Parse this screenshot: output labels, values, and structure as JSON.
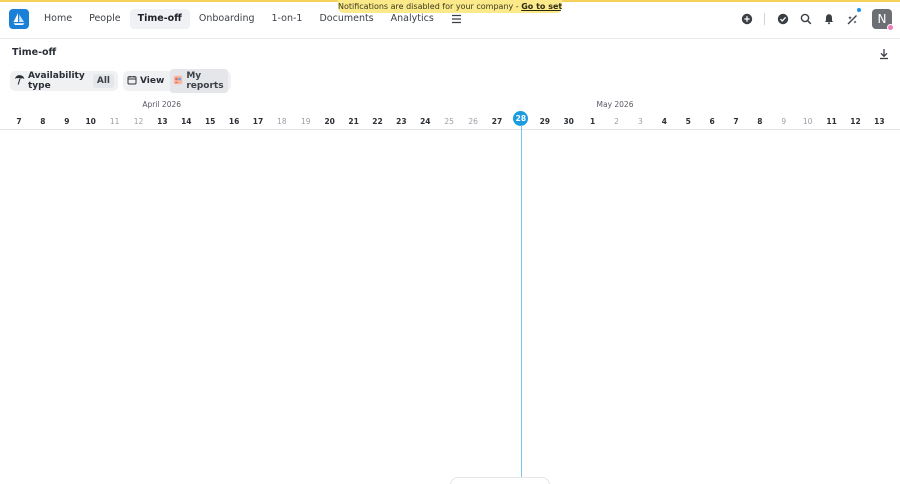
{
  "banner": {
    "text": "Notifications are disabled for your company - ",
    "link": "Go to settings"
  },
  "nav": {
    "logo": "sail-logo-icon",
    "items": [
      {
        "label": "Home",
        "active": false
      },
      {
        "label": "People",
        "active": false
      },
      {
        "label": "Time-off",
        "active": true
      },
      {
        "label": "Onboarding",
        "active": false
      },
      {
        "label": "1-on-1",
        "active": false
      },
      {
        "label": "Documents",
        "active": false
      },
      {
        "label": "Analytics",
        "active": false
      }
    ],
    "more_icon": "hamburger-icon",
    "right_icons": [
      "add-circle-icon",
      "check-circle-icon",
      "search-icon",
      "bell-icon",
      "sparkle-icon"
    ],
    "avatar_initial": "N",
    "accent_color": "#1a7fd6"
  },
  "page": {
    "title": "Time-off",
    "download_icon": "download-icon"
  },
  "filters": {
    "availability": {
      "icon": "beach-umbrella-icon",
      "label": "Availability type",
      "value": "All"
    },
    "view": {
      "icon": "calendar-icon",
      "label": "View",
      "chip_icon": "reports-icon",
      "chip_label": "My reports"
    }
  },
  "timeline": {
    "months": [
      {
        "label": "April 2026",
        "anchor_day_index": 6
      },
      {
        "label": "May 2026",
        "anchor_day_index": 25
      }
    ],
    "days": [
      {
        "d": "7",
        "weekend": false
      },
      {
        "d": "8",
        "weekend": false
      },
      {
        "d": "9",
        "weekend": false
      },
      {
        "d": "10",
        "weekend": false
      },
      {
        "d": "11",
        "weekend": true
      },
      {
        "d": "12",
        "weekend": true
      },
      {
        "d": "13",
        "weekend": false
      },
      {
        "d": "14",
        "weekend": false
      },
      {
        "d": "15",
        "weekend": false
      },
      {
        "d": "16",
        "weekend": false
      },
      {
        "d": "17",
        "weekend": false
      },
      {
        "d": "18",
        "weekend": true
      },
      {
        "d": "19",
        "weekend": true
      },
      {
        "d": "20",
        "weekend": false
      },
      {
        "d": "21",
        "weekend": false
      },
      {
        "d": "22",
        "weekend": false
      },
      {
        "d": "23",
        "weekend": false
      },
      {
        "d": "24",
        "weekend": false
      },
      {
        "d": "25",
        "weekend": true
      },
      {
        "d": "26",
        "weekend": true
      },
      {
        "d": "27",
        "weekend": false
      },
      {
        "d": "28",
        "weekend": false,
        "today": true
      },
      {
        "d": "29",
        "weekend": false
      },
      {
        "d": "30",
        "weekend": false
      },
      {
        "d": "1",
        "weekend": false
      },
      {
        "d": "2",
        "weekend": true
      },
      {
        "d": "3",
        "weekend": true
      },
      {
        "d": "4",
        "weekend": false
      },
      {
        "d": "5",
        "weekend": false
      },
      {
        "d": "6",
        "weekend": false
      },
      {
        "d": "7",
        "weekend": false
      },
      {
        "d": "8",
        "weekend": false
      },
      {
        "d": "9",
        "weekend": true
      },
      {
        "d": "10",
        "weekend": true
      },
      {
        "d": "11",
        "weekend": false
      },
      {
        "d": "12",
        "weekend": false
      },
      {
        "d": "13",
        "weekend": false
      }
    ],
    "today_color": "#1b9be0"
  }
}
